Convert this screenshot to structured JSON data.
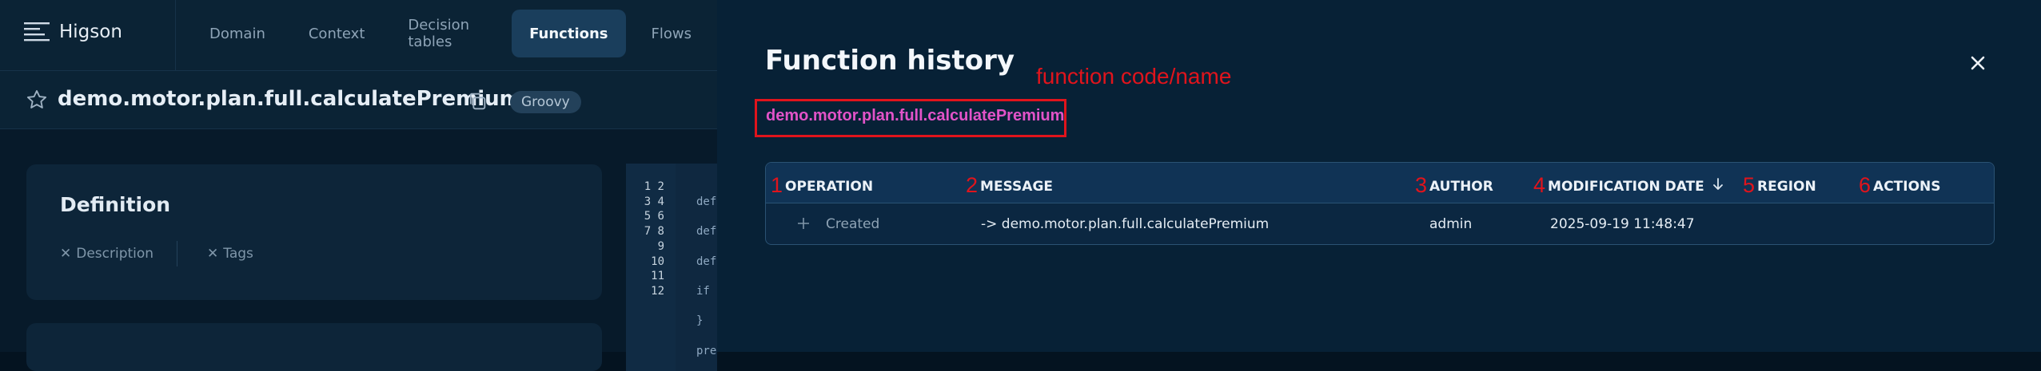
{
  "app": {
    "logo_text": "Higson",
    "nav_tabs": [
      "Domain",
      "Context",
      "Decision tables",
      "Functions",
      "Flows"
    ],
    "active_tab": "Functions",
    "function_name": "demo.motor.plan.full.calculatePremium",
    "language_badge": "Groovy",
    "definition_card": {
      "title": "Definition",
      "links": [
        "Description",
        "Tags"
      ]
    },
    "editor": {
      "line_numbers": [
        "1",
        "2",
        "3",
        "4",
        "5",
        "6",
        "7",
        "8",
        "9",
        "10",
        "11",
        "12"
      ],
      "code_lines": [
        "",
        "def",
        "",
        "def",
        "",
        "def",
        "",
        "if",
        "",
        "}",
        "",
        "pre"
      ]
    }
  },
  "panel": {
    "title": "Function history",
    "annotation": "function code/name",
    "function_code": "demo.motor.plan.full.calculatePremium",
    "columns": [
      {
        "num": "1",
        "label": "OPERATION"
      },
      {
        "num": "2",
        "label": "MESSAGE"
      },
      {
        "num": "3",
        "label": "AUTHOR"
      },
      {
        "num": "4",
        "label": "MODIFICATION DATE"
      },
      {
        "num": "5",
        "label": "REGION"
      },
      {
        "num": "6",
        "label": "ACTIONS"
      }
    ],
    "rows": [
      {
        "operation": "Created",
        "message": "-> demo.motor.plan.full.calculatePremium",
        "author": "admin",
        "modification_date": "2025-09-19 11:48:47",
        "region": "",
        "actions": ""
      }
    ]
  },
  "colors": {
    "accent_annotation": "#e0141c",
    "function_link": "#e253c8",
    "panel_bg": "#072136"
  }
}
